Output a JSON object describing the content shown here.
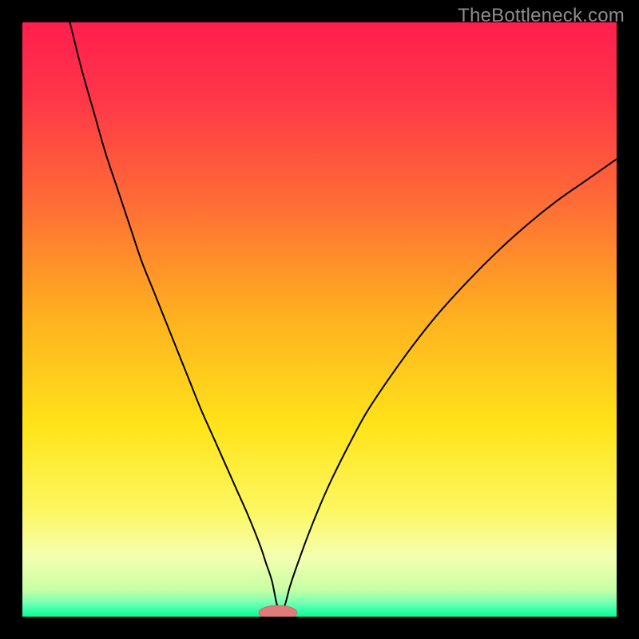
{
  "watermark": "TheBottleneck.com",
  "colors": {
    "frame": "#000000",
    "gradient_stops": [
      {
        "offset": 0.0,
        "color": "#ff1f4f"
      },
      {
        "offset": 0.12,
        "color": "#ff3449"
      },
      {
        "offset": 0.3,
        "color": "#ff6b36"
      },
      {
        "offset": 0.5,
        "color": "#ffb21f"
      },
      {
        "offset": 0.68,
        "color": "#ffe41a"
      },
      {
        "offset": 0.82,
        "color": "#fdf760"
      },
      {
        "offset": 0.9,
        "color": "#f4ffb0"
      },
      {
        "offset": 0.955,
        "color": "#c7ffa4"
      },
      {
        "offset": 0.975,
        "color": "#7dffb4"
      },
      {
        "offset": 1.0,
        "color": "#00ff99"
      }
    ],
    "curve": "#000000",
    "marker_fill": "#e27a7a",
    "marker_stroke": "#d06868"
  },
  "chart_data": {
    "type": "line",
    "title": "",
    "xlabel": "",
    "ylabel": "",
    "xlim": [
      0,
      100
    ],
    "ylim": [
      0,
      100
    ],
    "grid": false,
    "legend": false,
    "marker": {
      "x": 43,
      "y": 0,
      "rx": 3.2,
      "ry": 1.2
    },
    "series": [
      {
        "name": "curve",
        "x": [
          8,
          10,
          12,
          14,
          16,
          18,
          20,
          22,
          24,
          26,
          28,
          30,
          32,
          34,
          36,
          38,
          40,
          41,
          42,
          43,
          44,
          45,
          46,
          48,
          50,
          52,
          55,
          58,
          62,
          66,
          70,
          75,
          80,
          85,
          90,
          95,
          100
        ],
        "y": [
          100,
          92,
          85,
          78,
          72,
          66,
          60,
          55,
          50,
          45,
          40,
          35,
          30.5,
          26,
          21.5,
          17,
          12,
          9,
          6,
          1.5,
          1.5,
          5,
          8,
          13.5,
          18.5,
          23,
          29,
          34.5,
          40.5,
          46,
          51,
          56.5,
          61.5,
          66,
          70,
          73.5,
          77
        ]
      }
    ]
  }
}
